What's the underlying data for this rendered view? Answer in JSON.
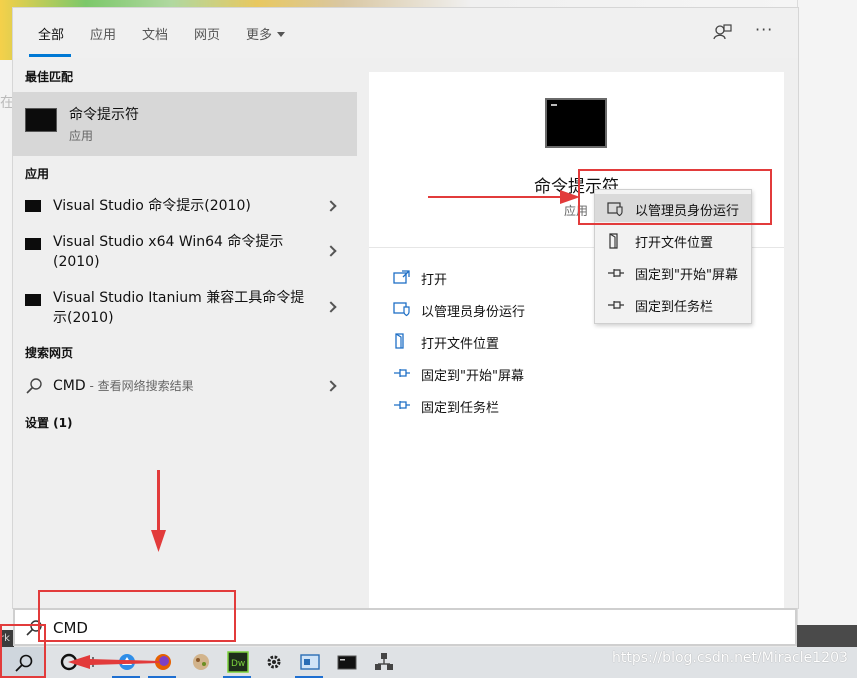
{
  "tabs": [
    "全部",
    "应用",
    "文档",
    "网页",
    "更多"
  ],
  "sections": {
    "best_match": "最佳匹配",
    "apps": "应用",
    "web": "搜索网页",
    "settings": "设置 (1)"
  },
  "best_match": {
    "title": "命令提示符",
    "type": "应用"
  },
  "apps": [
    {
      "label": "Visual Studio 命令提示(2010)"
    },
    {
      "label": "Visual Studio x64 Win64 命令提示(2010)"
    },
    {
      "label": "Visual Studio Itanium 兼容工具命令提示(2010)"
    }
  ],
  "web": {
    "query": "CMD",
    "hint": " - 查看网络搜索结果"
  },
  "detail": {
    "title": "命令提示符",
    "type": "应用",
    "actions": [
      "打开",
      "以管理员身份运行",
      "打开文件位置",
      "固定到\"开始\"屏幕",
      "固定到任务栏"
    ]
  },
  "context_menu": {
    "items": [
      "以管理员身份运行",
      "打开文件位置",
      "固定到\"开始\"屏幕",
      "固定到任务栏"
    ]
  },
  "search": {
    "value": "CMD"
  },
  "left_edge": {
    "char": "在",
    "rk": "rk"
  },
  "more_icon": "···",
  "watermark": "https://blog.csdn.net/Miracle1203",
  "colors": {
    "accent": "#0078d4",
    "annotation": "#e23b3b",
    "highlight": "#d7d7d7"
  },
  "icons": [
    "feedback-icon",
    "more-icon",
    "search-icon",
    "cmd-app-icon",
    "open-icon",
    "shield-icon",
    "folder-icon",
    "pin-icon",
    "chevron-right-icon"
  ]
}
